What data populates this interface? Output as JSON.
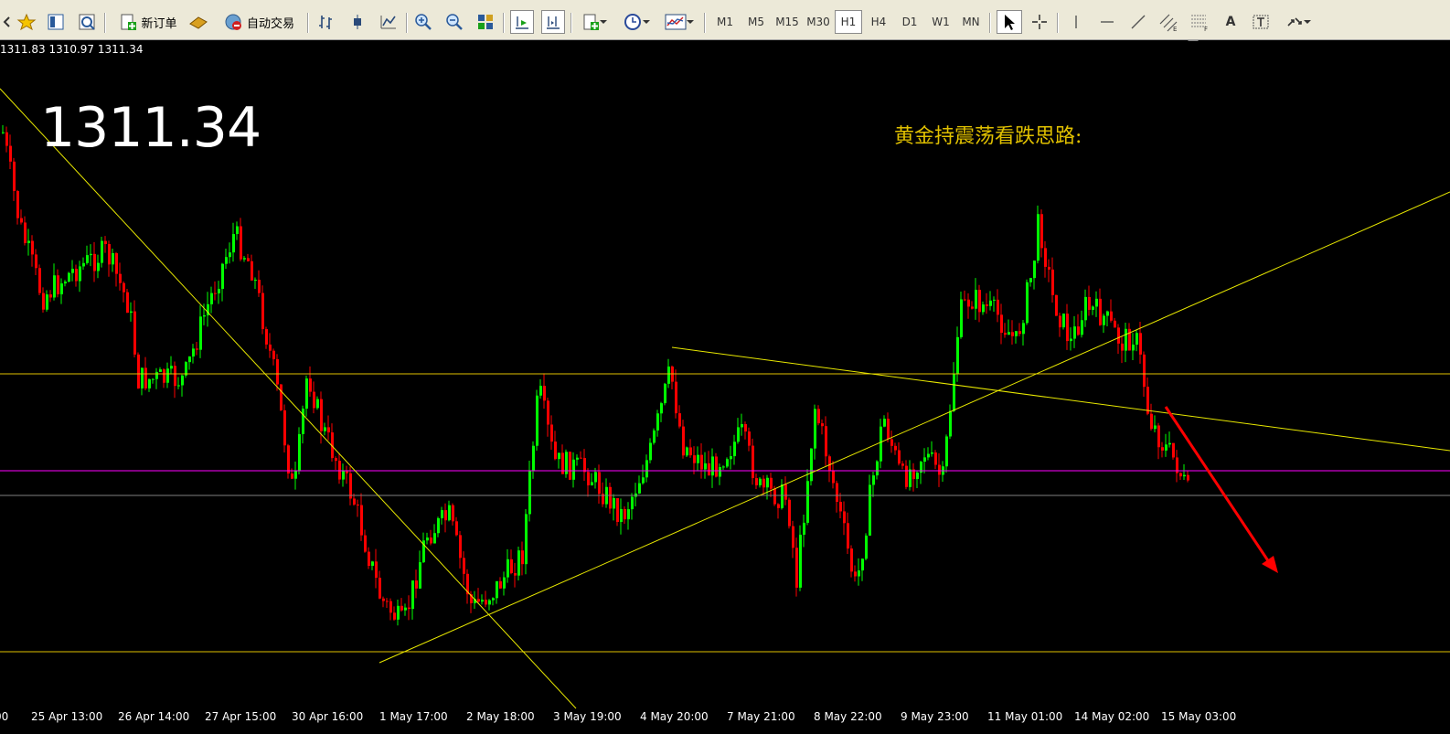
{
  "toolbar": {
    "new_order_label": "新订单",
    "auto_trading_label": "自动交易",
    "timeframes": [
      "M1",
      "M5",
      "M15",
      "M30",
      "H1",
      "H4",
      "D1",
      "W1",
      "MN"
    ],
    "active_timeframe": "H1",
    "text_tool_label": "A"
  },
  "chart": {
    "ohlc_text": "1311.83 1310.97 1311.34",
    "current_price": "1311.34",
    "annotation": "黄金持震荡看跌思路:",
    "x_labels": [
      "25 Apr 13:00",
      "26 Apr 14:00",
      "27 Apr 15:00",
      "30 Apr 16:00",
      "1 May 17:00",
      "2 May 18:00",
      "3 May 19:00",
      "4 May 20:00",
      "7 May 21:00",
      "8 May 22:00",
      "9 May 23:00",
      "11 May 01:00",
      "14 May 02:00",
      "15 May 03:00"
    ],
    "colors": {
      "background": "#000000",
      "bull_candle": "#00ff00",
      "bear_candle": "#ff0000",
      "trendline": "#e8e800",
      "level_line": "#e0c000",
      "magenta_line": "#ff00ff",
      "bid_line": "#808080",
      "arrow": "#ff0000"
    }
  }
}
